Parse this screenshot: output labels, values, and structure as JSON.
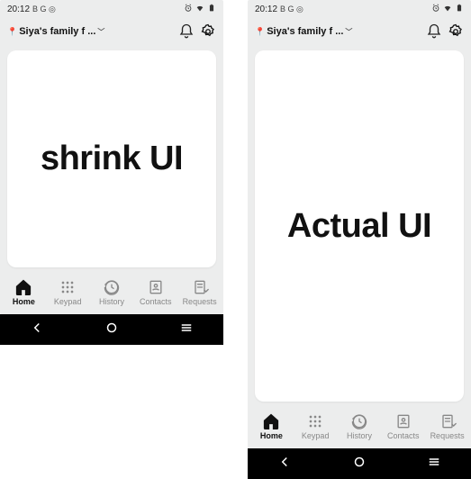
{
  "statusbar": {
    "time": "20:12",
    "indicators": "B G ◎",
    "right_glyphs": "⏰ ▾▴ ▮"
  },
  "header": {
    "breadcrumb_text": "Siya's family f ...",
    "bell_label": "notifications",
    "gear_label": "settings"
  },
  "left_card": {
    "text": "shrink UI"
  },
  "right_card": {
    "text": "Actual UI"
  },
  "tabs": {
    "home": "Home",
    "keypad": "Keypad",
    "history": "History",
    "contacts": "Contacts",
    "requests": "Requests"
  }
}
